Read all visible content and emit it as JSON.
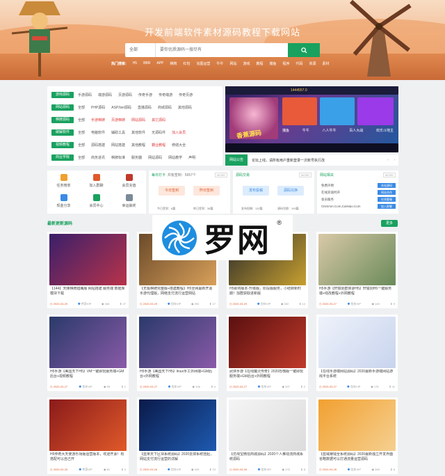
{
  "header": {
    "site_title": "开发前端软件素材源码教程下载网站",
    "search": {
      "select_value": "全部",
      "placeholder": "要你优质源码一搜尽有",
      "button_icon": "search-icon"
    },
    "hot_label": "热门搜索:",
    "hot_items": [
      "H5",
      "BBR",
      "APP",
      "棋牌",
      "红包",
      "充图运营",
      "牛牛",
      "网站",
      "游戏",
      "教程",
      "捕鱼",
      "程序",
      "代码",
      "资源",
      "素材"
    ]
  },
  "categories": [
    {
      "tag": "游戏源码",
      "color": "#19a15f",
      "items": [
        "手游源码",
        "端游源码",
        "页游源码",
        "传奇手游",
        "传奇端游",
        "传奇页游"
      ]
    },
    {
      "tag": "网站源码",
      "color": "#19a15f",
      "items": [
        "全部",
        "PHP源码",
        "ASP.Net源码",
        "直播源码",
        "商城源码",
        "其他源码"
      ]
    },
    {
      "tag": "棋牌源码",
      "color": "#19a15f",
      "items": [
        "全部",
        "手游棋牌",
        "页游棋牌",
        "网站源码",
        "其它源码"
      ]
    },
    {
      "tag": "破解软件",
      "color": "#19a15f",
      "items": [
        "全部",
        "电脑软件",
        "辅助工具",
        "其他软件",
        "无源码件",
        "加入会员"
      ]
    },
    {
      "tag": "视频教程",
      "color": "#19a15f",
      "items": [
        "全部",
        "源码搭建",
        "网站搭建",
        "其他教程",
        "霸业教程",
        "修缮大全"
      ]
    },
    {
      "tag": "商业学院",
      "color": "#19a15f",
      "items": [
        "全部",
        "商务进讯",
        "棋牌标准",
        "服务器",
        "网站源码",
        "网站教学",
        "声明"
      ]
    }
  ],
  "banner": {
    "game_label": "香蕉源码",
    "badge": "1444557.0",
    "strip": [
      "捕鱼",
      "牛牛",
      "八人牛牛",
      "百人大战",
      "欢乐斗地主"
    ]
  },
  "notice": {
    "label": "网站公告",
    "text": "论坛上线，请所有用户重新登录一次账号执行改"
  },
  "quick_links": [
    {
      "label": "任务榜单",
      "icon": "list-icon",
      "color": "#f0a030"
    },
    {
      "label": "加入群聊",
      "icon": "chat-icon",
      "color": "#e05a2a"
    },
    {
      "label": "会员充值",
      "icon": "vip-icon",
      "color": "#c0392b"
    },
    {
      "label": "现金分享",
      "icon": "share-icon",
      "color": "#3b8be5"
    },
    {
      "label": "会员中心",
      "icon": "user-icon",
      "color": "#19a15f"
    },
    {
      "label": "幸运抽奖",
      "icon": "gift-icon",
      "color": "#7a8a99"
    }
  ],
  "checkin": {
    "title": "每日打卡",
    "count_text": "共有签到：5657个",
    "more": "MORE",
    "btn1": "今日签到",
    "btn2": "昨日签到",
    "stat1": "今日签到：8篇",
    "stat2": "昨日签到：38篇"
  },
  "exchange": {
    "title": "源码交易",
    "more": "MORE",
    "btn1": "发布投稿",
    "btn2": "源码兑换",
    "stat1": "发布投稿：132篇",
    "stat2": "源码兑换：193篇"
  },
  "links": {
    "title": "网站相关",
    "more": "MORE",
    "rows": [
      "免费声明",
      "在线充值时开",
      "会员服务",
      "CNmmm.Com,CaiNiao.Com"
    ],
    "buttons": [
      "本站源码",
      "网站合作",
      "在线客服",
      "加入群聊"
    ]
  },
  "section": {
    "title": "最新更新源码",
    "more": "更多"
  },
  "cards": [
    {
      "title": "【144】天降棋牌猎鹰版 网站搭建 服务端 数据库 模块下载",
      "date": "2020-03-29",
      "vip": "传奇VIP",
      "views": "446",
      "dl": "27"
    },
    {
      "title": "【无极棋牌完整版+搭建教程】H5全网最新开源手游代理版，网络支付流行运营网站",
      "date": "2020-03-29",
      "vip": "包年VIP",
      "views": "292",
      "dl": "17"
    },
    {
      "title": "H5即将版本-升级版，阶段版服务，小结转新时期！加群获取进新版",
      "date": "2020-03-29",
      "vip": "包年VIP",
      "views": "332",
      "dl": "14"
    },
    {
      "title": "H5手游【轩辕剑群侠录H5】轩辕剑H5一键服务端+线改教程+外网教程",
      "date": "2020-03-27",
      "vip": "包年VIP",
      "views": "149",
      "dl": "9"
    },
    {
      "title": "H5手游【美国天下H5】VM一键即玩服务端+GM后台+视频教程",
      "date": "2020-03-27",
      "vip": "包年VIP",
      "views": "95",
      "dl": "1"
    },
    {
      "title": "H5手游【美国天下H5】linux手工外网端+GM后台+外网教程",
      "date": "2020-03-27",
      "vip": "包年VIP",
      "views": "106",
      "dl": "4"
    },
    {
      "title": "武侠手游【在线魔灵传奇】2020恐慌版一键即玩服务端+GM后台+外网教程",
      "date": "2020-03-27",
      "vip": "包年VIP",
      "views": "297",
      "dl": "2"
    },
    {
      "title": "【在线手游端网站源码】2020最新手游端网站游戏平台系统",
      "date": "2020-03-27",
      "vip": "包年VIP",
      "views": "175",
      "dl": "11"
    },
    {
      "title": "H5传奇大天使游乐场版运营版本，欢迎开源！有搭配可以自己开",
      "date": "2020-03-26",
      "vip": "传奇VIP",
      "views": "81",
      "dl": "0"
    },
    {
      "title": "【蓝果天下区块系统源码】2020去掉系统挂起，网站支付流行运营的详解",
      "date": "2020-03-26",
      "vip": "包年VIP",
      "views": "323",
      "dl": "10"
    },
    {
      "title": "【仿淘宝微信商城源码】2020个人推动流商城系统源码",
      "date": "2020-03-26",
      "vip": "包年VIP",
      "views": "175",
      "dl": "8"
    },
    {
      "title": "【蓝域赚钱全系统源码】2020最新独立开发界面省略数据可以打通流量运营源码",
      "date": "2020-03-26",
      "vip": "包年VIP",
      "views": "269",
      "dl": "6"
    }
  ],
  "watermark": {
    "text": "罗网",
    "reg": "®"
  }
}
